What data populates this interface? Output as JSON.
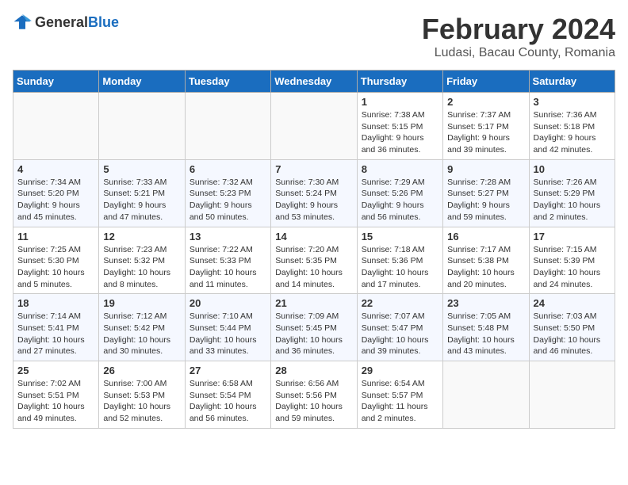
{
  "header": {
    "logo_general": "General",
    "logo_blue": "Blue",
    "title": "February 2024",
    "location": "Ludasi, Bacau County, Romania"
  },
  "weekdays": [
    "Sunday",
    "Monday",
    "Tuesday",
    "Wednesday",
    "Thursday",
    "Friday",
    "Saturday"
  ],
  "weeks": [
    [
      {
        "day": "",
        "sunrise": "",
        "sunset": "",
        "daylight": ""
      },
      {
        "day": "",
        "sunrise": "",
        "sunset": "",
        "daylight": ""
      },
      {
        "day": "",
        "sunrise": "",
        "sunset": "",
        "daylight": ""
      },
      {
        "day": "",
        "sunrise": "",
        "sunset": "",
        "daylight": ""
      },
      {
        "day": "1",
        "sunrise": "Sunrise: 7:38 AM",
        "sunset": "Sunset: 5:15 PM",
        "daylight": "Daylight: 9 hours and 36 minutes."
      },
      {
        "day": "2",
        "sunrise": "Sunrise: 7:37 AM",
        "sunset": "Sunset: 5:17 PM",
        "daylight": "Daylight: 9 hours and 39 minutes."
      },
      {
        "day": "3",
        "sunrise": "Sunrise: 7:36 AM",
        "sunset": "Sunset: 5:18 PM",
        "daylight": "Daylight: 9 hours and 42 minutes."
      }
    ],
    [
      {
        "day": "4",
        "sunrise": "Sunrise: 7:34 AM",
        "sunset": "Sunset: 5:20 PM",
        "daylight": "Daylight: 9 hours and 45 minutes."
      },
      {
        "day": "5",
        "sunrise": "Sunrise: 7:33 AM",
        "sunset": "Sunset: 5:21 PM",
        "daylight": "Daylight: 9 hours and 47 minutes."
      },
      {
        "day": "6",
        "sunrise": "Sunrise: 7:32 AM",
        "sunset": "Sunset: 5:23 PM",
        "daylight": "Daylight: 9 hours and 50 minutes."
      },
      {
        "day": "7",
        "sunrise": "Sunrise: 7:30 AM",
        "sunset": "Sunset: 5:24 PM",
        "daylight": "Daylight: 9 hours and 53 minutes."
      },
      {
        "day": "8",
        "sunrise": "Sunrise: 7:29 AM",
        "sunset": "Sunset: 5:26 PM",
        "daylight": "Daylight: 9 hours and 56 minutes."
      },
      {
        "day": "9",
        "sunrise": "Sunrise: 7:28 AM",
        "sunset": "Sunset: 5:27 PM",
        "daylight": "Daylight: 9 hours and 59 minutes."
      },
      {
        "day": "10",
        "sunrise": "Sunrise: 7:26 AM",
        "sunset": "Sunset: 5:29 PM",
        "daylight": "Daylight: 10 hours and 2 minutes."
      }
    ],
    [
      {
        "day": "11",
        "sunrise": "Sunrise: 7:25 AM",
        "sunset": "Sunset: 5:30 PM",
        "daylight": "Daylight: 10 hours and 5 minutes."
      },
      {
        "day": "12",
        "sunrise": "Sunrise: 7:23 AM",
        "sunset": "Sunset: 5:32 PM",
        "daylight": "Daylight: 10 hours and 8 minutes."
      },
      {
        "day": "13",
        "sunrise": "Sunrise: 7:22 AM",
        "sunset": "Sunset: 5:33 PM",
        "daylight": "Daylight: 10 hours and 11 minutes."
      },
      {
        "day": "14",
        "sunrise": "Sunrise: 7:20 AM",
        "sunset": "Sunset: 5:35 PM",
        "daylight": "Daylight: 10 hours and 14 minutes."
      },
      {
        "day": "15",
        "sunrise": "Sunrise: 7:18 AM",
        "sunset": "Sunset: 5:36 PM",
        "daylight": "Daylight: 10 hours and 17 minutes."
      },
      {
        "day": "16",
        "sunrise": "Sunrise: 7:17 AM",
        "sunset": "Sunset: 5:38 PM",
        "daylight": "Daylight: 10 hours and 20 minutes."
      },
      {
        "day": "17",
        "sunrise": "Sunrise: 7:15 AM",
        "sunset": "Sunset: 5:39 PM",
        "daylight": "Daylight: 10 hours and 24 minutes."
      }
    ],
    [
      {
        "day": "18",
        "sunrise": "Sunrise: 7:14 AM",
        "sunset": "Sunset: 5:41 PM",
        "daylight": "Daylight: 10 hours and 27 minutes."
      },
      {
        "day": "19",
        "sunrise": "Sunrise: 7:12 AM",
        "sunset": "Sunset: 5:42 PM",
        "daylight": "Daylight: 10 hours and 30 minutes."
      },
      {
        "day": "20",
        "sunrise": "Sunrise: 7:10 AM",
        "sunset": "Sunset: 5:44 PM",
        "daylight": "Daylight: 10 hours and 33 minutes."
      },
      {
        "day": "21",
        "sunrise": "Sunrise: 7:09 AM",
        "sunset": "Sunset: 5:45 PM",
        "daylight": "Daylight: 10 hours and 36 minutes."
      },
      {
        "day": "22",
        "sunrise": "Sunrise: 7:07 AM",
        "sunset": "Sunset: 5:47 PM",
        "daylight": "Daylight: 10 hours and 39 minutes."
      },
      {
        "day": "23",
        "sunrise": "Sunrise: 7:05 AM",
        "sunset": "Sunset: 5:48 PM",
        "daylight": "Daylight: 10 hours and 43 minutes."
      },
      {
        "day": "24",
        "sunrise": "Sunrise: 7:03 AM",
        "sunset": "Sunset: 5:50 PM",
        "daylight": "Daylight: 10 hours and 46 minutes."
      }
    ],
    [
      {
        "day": "25",
        "sunrise": "Sunrise: 7:02 AM",
        "sunset": "Sunset: 5:51 PM",
        "daylight": "Daylight: 10 hours and 49 minutes."
      },
      {
        "day": "26",
        "sunrise": "Sunrise: 7:00 AM",
        "sunset": "Sunset: 5:53 PM",
        "daylight": "Daylight: 10 hours and 52 minutes."
      },
      {
        "day": "27",
        "sunrise": "Sunrise: 6:58 AM",
        "sunset": "Sunset: 5:54 PM",
        "daylight": "Daylight: 10 hours and 56 minutes."
      },
      {
        "day": "28",
        "sunrise": "Sunrise: 6:56 AM",
        "sunset": "Sunset: 5:56 PM",
        "daylight": "Daylight: 10 hours and 59 minutes."
      },
      {
        "day": "29",
        "sunrise": "Sunrise: 6:54 AM",
        "sunset": "Sunset: 5:57 PM",
        "daylight": "Daylight: 11 hours and 2 minutes."
      },
      {
        "day": "",
        "sunrise": "",
        "sunset": "",
        "daylight": ""
      },
      {
        "day": "",
        "sunrise": "",
        "sunset": "",
        "daylight": ""
      }
    ]
  ]
}
